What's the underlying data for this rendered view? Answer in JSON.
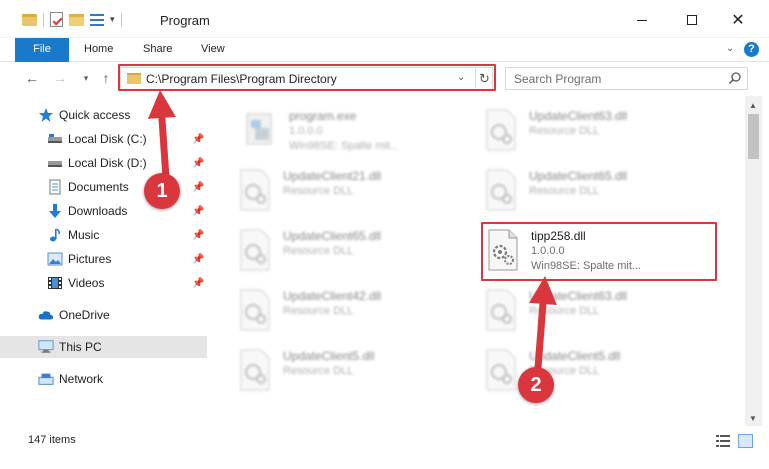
{
  "window": {
    "title": "Program",
    "minimize_label": "Minimize",
    "maximize_label": "Maximize",
    "close_label": "✕"
  },
  "ribbon": {
    "tabs": [
      {
        "label": "File"
      },
      {
        "label": "Home"
      },
      {
        "label": "Share"
      },
      {
        "label": "View"
      }
    ],
    "help_label": "?"
  },
  "address_bar": {
    "path": "C:\\Program Files\\Program Directory"
  },
  "search": {
    "placeholder": "Search Program"
  },
  "sidebar": {
    "items": [
      {
        "label": "Quick access",
        "icon": "star-icon",
        "pinned": false
      },
      {
        "label": "Local Disk (C:)",
        "icon": "drive-icon",
        "pinned": true
      },
      {
        "label": "Local Disk (D:)",
        "icon": "drive-icon",
        "pinned": true
      },
      {
        "label": "Documents",
        "icon": "documents-icon",
        "pinned": true
      },
      {
        "label": "Downloads",
        "icon": "download-icon",
        "pinned": true
      },
      {
        "label": "Music",
        "icon": "music-icon",
        "pinned": true
      },
      {
        "label": "Pictures",
        "icon": "pictures-icon",
        "pinned": true
      },
      {
        "label": "Videos",
        "icon": "videos-icon",
        "pinned": true
      },
      {
        "label": "OneDrive",
        "icon": "cloud-icon",
        "pinned": false
      },
      {
        "label": "This PC",
        "icon": "computer-icon",
        "pinned": false,
        "selected": true
      },
      {
        "label": "Network",
        "icon": "network-icon",
        "pinned": false
      }
    ]
  },
  "files": [
    {
      "name": "program.exe",
      "line2": "1.0.0.0",
      "line3": "Win98SE: Spalte mit...",
      "type": "exe",
      "blurred": true
    },
    {
      "name": "UpdateClient63.dll",
      "line2": "Resource DLL",
      "line3": "",
      "type": "dll",
      "blurred": true
    },
    {
      "name": "UpdateClient21.dll",
      "line2": "Resource DLL",
      "line3": "",
      "type": "dll",
      "blurred": true
    },
    {
      "name": "UpdateClient65.dll",
      "line2": "Resource DLL",
      "line3": "",
      "type": "dll",
      "blurred": true
    },
    {
      "name": "UpdateClient65.dll",
      "line2": "Resource DLL",
      "line3": "",
      "type": "dll",
      "blurred": true
    },
    {
      "name": "tipp258.dll",
      "line2": "1.0.0.0",
      "line3": "Win98SE: Spalte mit...",
      "type": "dll",
      "blurred": false
    },
    {
      "name": "UpdateClient42.dll",
      "line2": "Resource DLL",
      "line3": "",
      "type": "dll",
      "blurred": true
    },
    {
      "name": "UpdateClient63.dll",
      "line2": "Resource DLL",
      "line3": "",
      "type": "dll",
      "blurred": true
    },
    {
      "name": "UpdateClient5.dll",
      "line2": "Resource DLL",
      "line3": "",
      "type": "dll",
      "blurred": true
    },
    {
      "name": "UpdateClient5.dll",
      "line2": "Resource DLL",
      "line3": "",
      "type": "dll",
      "blurred": true
    }
  ],
  "status": {
    "item_count": "147 items"
  },
  "callouts": {
    "first": "1",
    "second": "2"
  },
  "colors": {
    "accent": "#1979ca",
    "highlight": "#d9363e",
    "selected_bg": "#e5e5e5"
  }
}
